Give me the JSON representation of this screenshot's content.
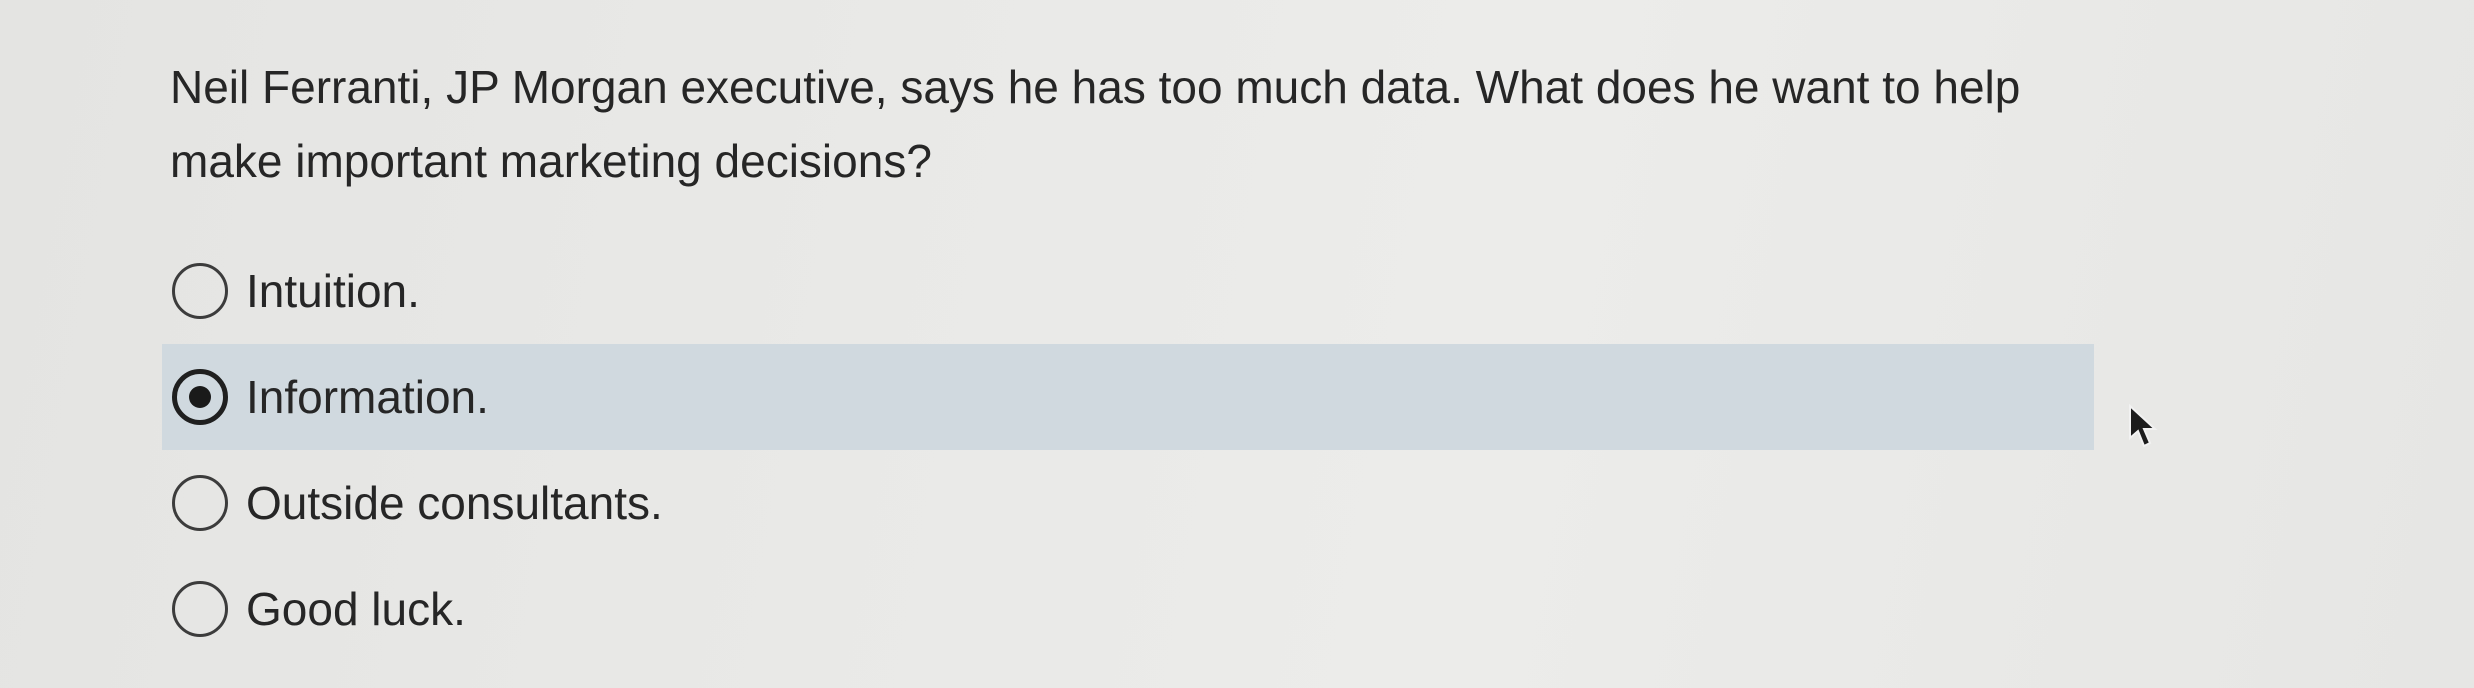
{
  "question": {
    "text": "Neil Ferranti, JP Morgan executive, says he has too much data. What does he want to help make important marketing decisions?"
  },
  "options": [
    {
      "label": "Intuition.",
      "selected": false
    },
    {
      "label": "Information.",
      "selected": true
    },
    {
      "label": "Outside consultants.",
      "selected": false
    },
    {
      "label": "Good luck.",
      "selected": false
    }
  ],
  "colors": {
    "background": "#e8e8e6",
    "selected_row": "#d0d9df",
    "text": "#262626"
  },
  "icons": {
    "cursor": "mouse-pointer-icon"
  }
}
